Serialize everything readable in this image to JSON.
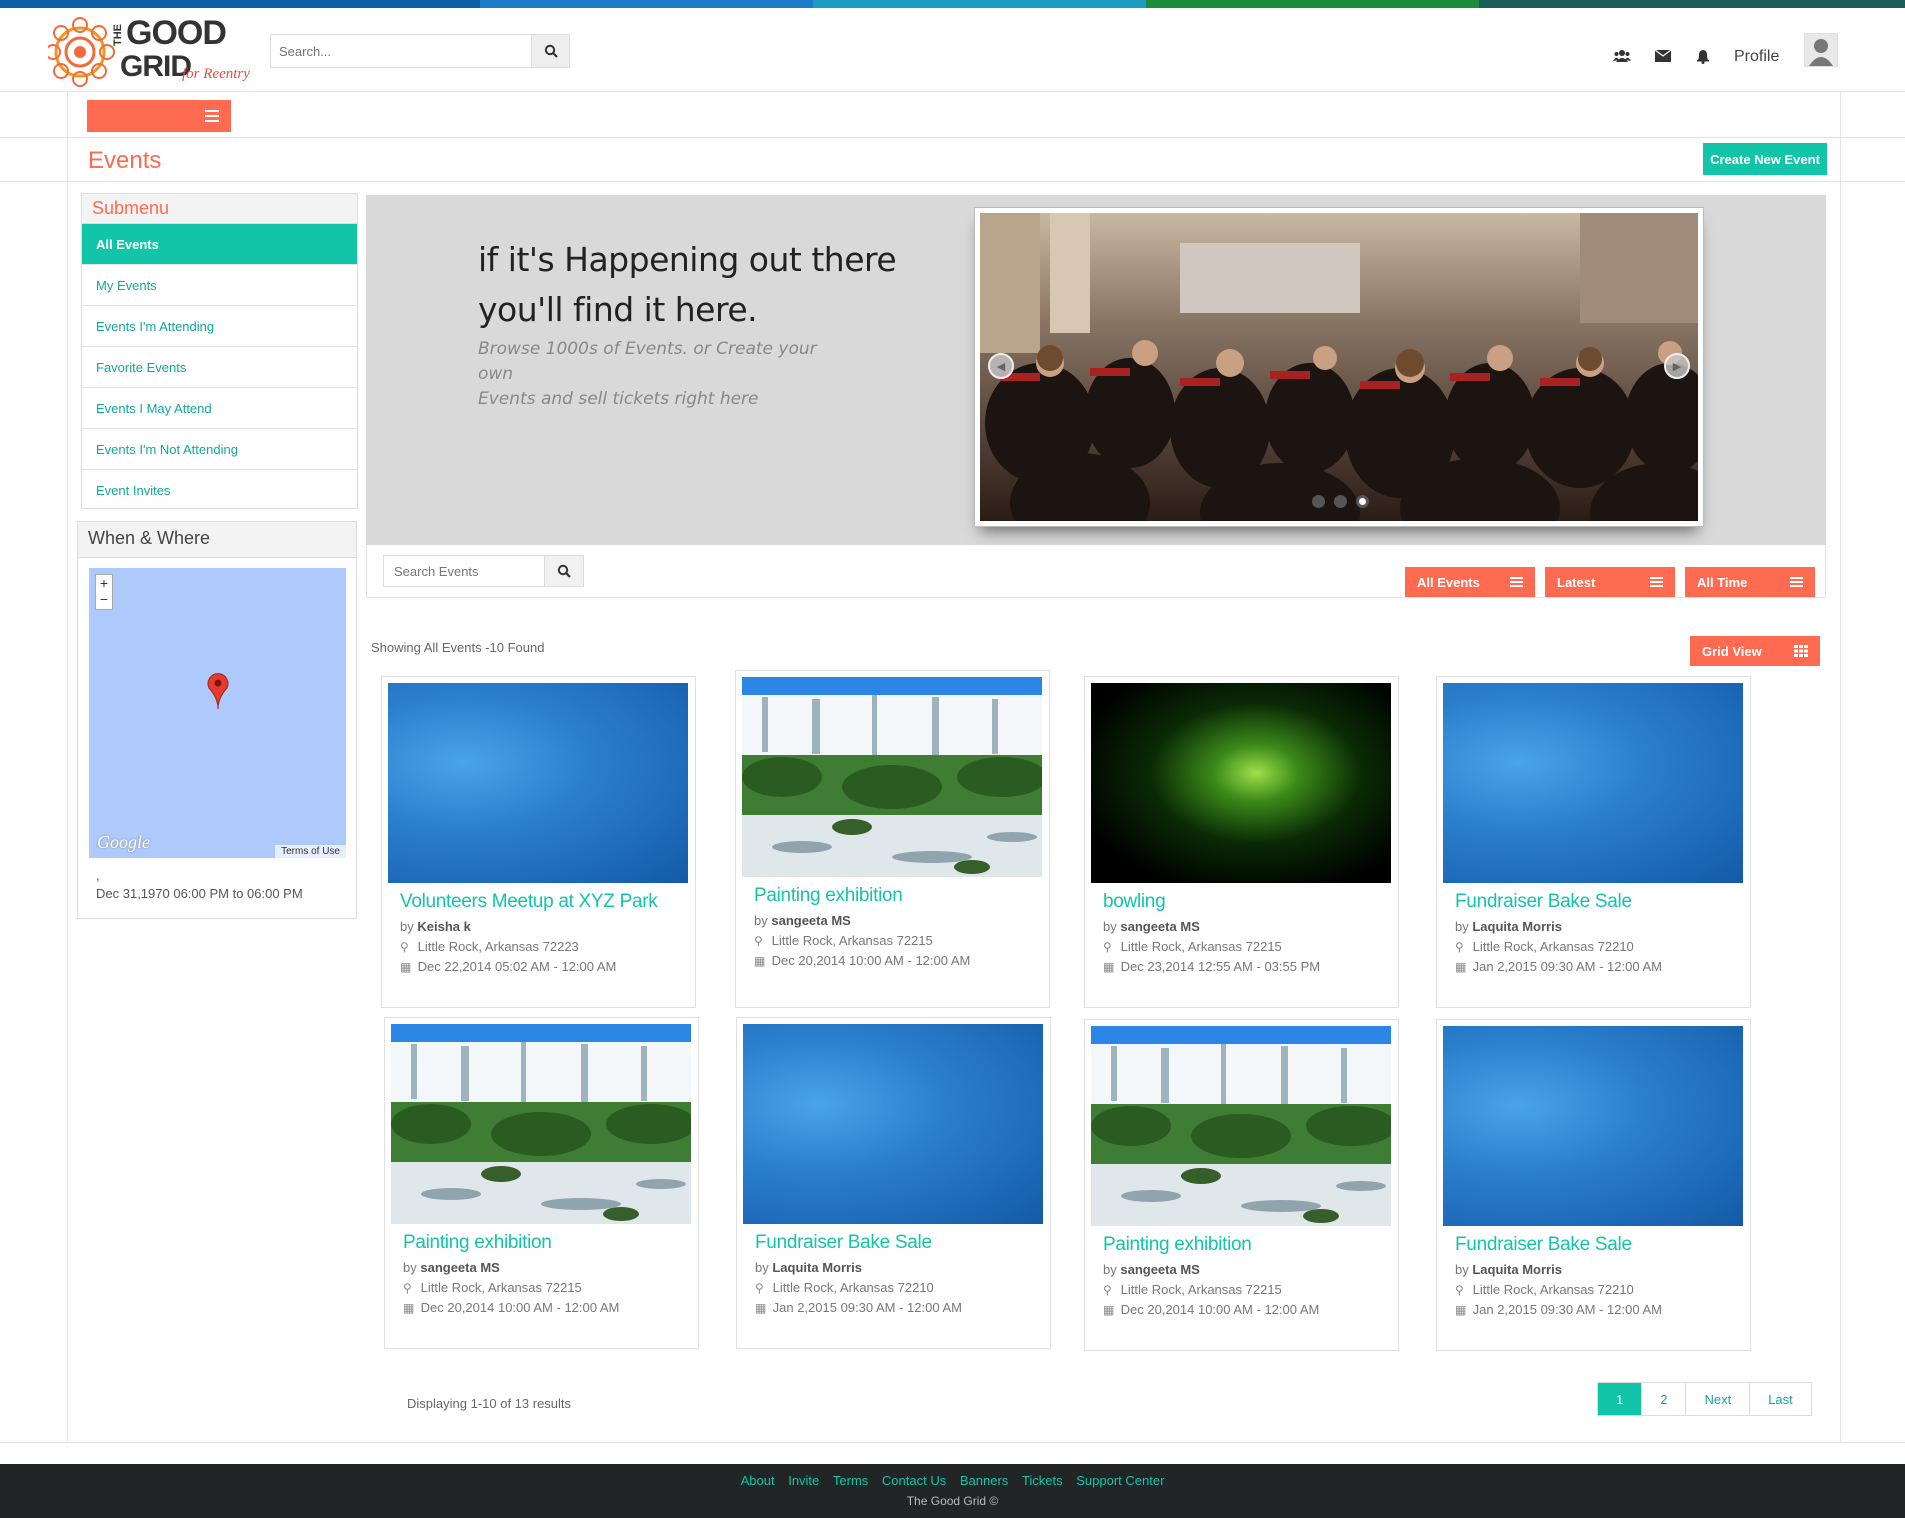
{
  "brand": {
    "logo_word1": "THE",
    "logo_word2": "GOOD",
    "logo_word3": "GRID",
    "logo_tagline": "for Reentry"
  },
  "header": {
    "search_placeholder": "Search...",
    "icons": [
      "users-icon",
      "envelope-icon",
      "bell-icon"
    ],
    "profile_label": "Profile"
  },
  "page": {
    "title": "Events",
    "create_button": "Create New Event"
  },
  "submenu": {
    "title": "Submenu",
    "items": [
      {
        "label": "All Events",
        "active": true
      },
      {
        "label": "My Events"
      },
      {
        "label": "Events I'm Attending"
      },
      {
        "label": "Favorite Events"
      },
      {
        "label": "Events I May Attend"
      },
      {
        "label": "Events I'm Not Attending"
      },
      {
        "label": "Event Invites"
      }
    ]
  },
  "when_where": {
    "title": "When & Where",
    "map_brand": "Google",
    "map_terms": "Terms of Use",
    "location_line": ",",
    "date_line": "Dec 31,1970 06:00 PM to 06:00 PM"
  },
  "hero": {
    "headline_line1": "if it's Happening out there",
    "headline_line2": "you'll find it here.",
    "subtext_line1": "Browse 1000s of Events. or Create your own",
    "subtext_line2": "Events and sell tickets right here",
    "slide_count": 3,
    "active_slide": 3
  },
  "filters": {
    "search_placeholder": "Search Events",
    "dropdowns": [
      "All Events",
      "Latest",
      "All Time"
    ]
  },
  "results": {
    "showing": "Showing All Events -10 Found",
    "view_button": "Grid View",
    "events": [
      {
        "title": "Volunteers Meetup at XYZ Park",
        "by": "by",
        "author": "Keisha k",
        "location": "Little Rock, Arkansas 72223",
        "date": "Dec 22,2014 05:02 AM - 12:00 AM",
        "image": "blue"
      },
      {
        "title": "Painting exhibition",
        "by": "by",
        "author": "sangeeta MS",
        "location": "Little Rock, Arkansas 72215",
        "date": "Dec 20,2014 10:00 AM - 12:00 AM",
        "image": "waterfall"
      },
      {
        "title": "bowling",
        "by": "by",
        "author": "sangeeta MS",
        "location": "Little Rock, Arkansas 72215",
        "date": "Dec 23,2014 12:55 AM - 03:55 PM",
        "image": "aurora"
      },
      {
        "title": "Fundraiser Bake Sale",
        "by": "by",
        "author": "Laquita Morris",
        "location": "Little Rock, Arkansas 72210",
        "date": "Jan 2,2015 09:30 AM - 12:00 AM",
        "image": "blue"
      },
      {
        "title": "Painting exhibition",
        "by": "by",
        "author": "sangeeta MS",
        "location": "Little Rock, Arkansas 72215",
        "date": "Dec 20,2014 10:00 AM - 12:00 AM",
        "image": "waterfall"
      },
      {
        "title": "Fundraiser Bake Sale",
        "by": "by",
        "author": "Laquita Morris",
        "location": "Little Rock, Arkansas 72210",
        "date": "Jan 2,2015 09:30 AM - 12:00 AM",
        "image": "blue"
      },
      {
        "title": "Painting exhibition",
        "by": "by",
        "author": "sangeeta MS",
        "location": "Little Rock, Arkansas 72215",
        "date": "Dec 20,2014 10:00 AM - 12:00 AM",
        "image": "waterfall"
      },
      {
        "title": "Fundraiser Bake Sale",
        "by": "by",
        "author": "Laquita Morris",
        "location": "Little Rock, Arkansas 72210",
        "date": "Jan 2,2015 09:30 AM - 12:00 AM",
        "image": "blue"
      }
    ]
  },
  "pagination": {
    "displaying": "Displaying 1-10 of 13 results",
    "pages": [
      "1",
      "2",
      "Next",
      "Last"
    ],
    "active": "1"
  },
  "footer": {
    "links": [
      "About",
      "Invite",
      "Terms",
      "Contact Us",
      "Banners",
      "Tickets",
      "Support Center"
    ],
    "copyright": "The Good Grid ©"
  },
  "colors": {
    "accent_teal": "#12c5a9",
    "accent_orange": "#ff6b51",
    "footer_bg": "#212526",
    "top_stripe": [
      "#0b5ea8",
      "#1a7bc6",
      "#1a9bbf",
      "#1d8c3a",
      "#1a5e58"
    ]
  }
}
